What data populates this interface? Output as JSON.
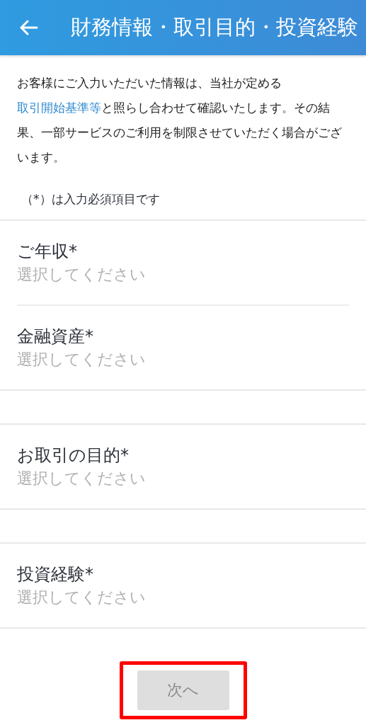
{
  "header": {
    "title": "財務情報・取引目的・投資経験"
  },
  "intro": {
    "before": "お客様にご入力いただいた情報は、当社が定める",
    "link": "取引開始基準等",
    "after": "と照らし合わせて確認いたします。その結果、一部サービスのご利用を制限させていただく場合がございます。"
  },
  "required_note": "（*）は入力必須項目です",
  "groups": [
    {
      "fields": [
        {
          "label": "ご年収*",
          "placeholder": "選択してください"
        },
        {
          "label": "金融資産*",
          "placeholder": "選択してください"
        }
      ]
    },
    {
      "fields": [
        {
          "label": "お取引の目的*",
          "placeholder": "選択してください"
        }
      ]
    },
    {
      "fields": [
        {
          "label": "投資経験*",
          "placeholder": "選択してください"
        }
      ]
    }
  ],
  "next_button": {
    "label": "次へ",
    "disabled": true,
    "highlighted": true
  }
}
